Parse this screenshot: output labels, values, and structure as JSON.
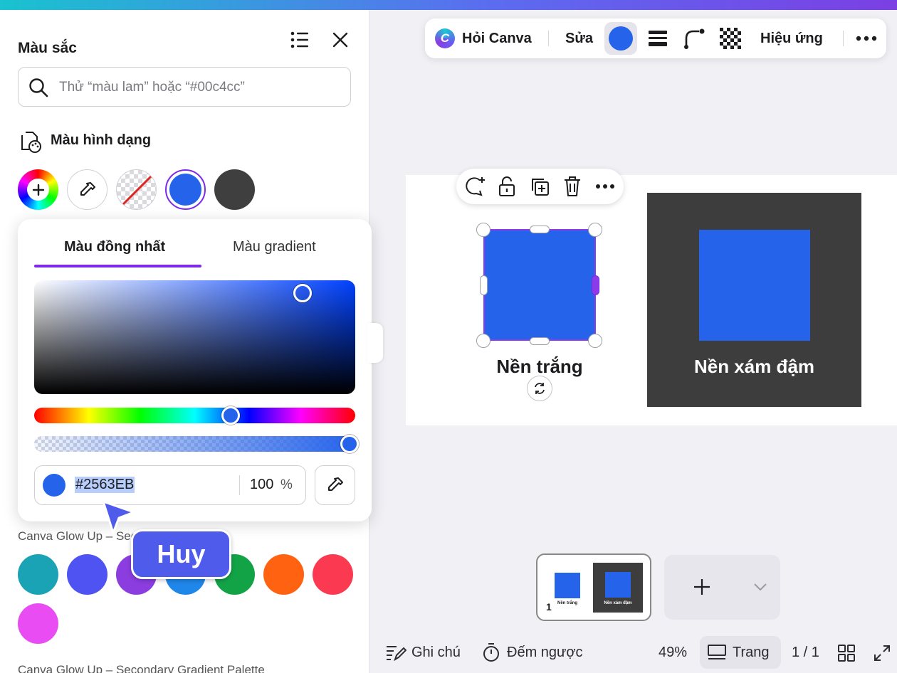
{
  "panel": {
    "title": "Màu sắc",
    "search_placeholder": "Thử “màu lam” hoặc “#00c4cc”",
    "section_label": "Màu hình dạng",
    "doc_colors": [
      "#2563EB",
      "#3F3F3F"
    ],
    "picker": {
      "tab_solid": "Màu đồng nhất",
      "tab_gradient": "Màu gradient",
      "hex_value": "#2563EB",
      "opacity": "100",
      "opacity_unit": "%"
    },
    "palette1_label": "Canva Glow Up – Secondary Palette",
    "palette1_colors": [
      "#1aa3b4",
      "#4f53f1",
      "#8b3ddf",
      "#1f86ea",
      "#13a347",
      "#ff6312",
      "#fb3a52",
      "#e84cf2"
    ],
    "palette2_label": "Canva Glow Up – Secondary Gradient Palette"
  },
  "toolbar": {
    "ask_canva": "Hỏi Canva",
    "edit": "Sửa",
    "current_color": "#2563EB",
    "effects": "Hiệu ứng"
  },
  "canvas": {
    "shape_color": "#2563EB",
    "dark_bg_color": "#3D3D3D",
    "label_white": "Nền trắng",
    "label_dark": "Nền xám đậm"
  },
  "thumbnail": {
    "page_number": "1",
    "label_white": "Nền trắng",
    "label_dark": "Nền xám đậm"
  },
  "cursor": {
    "user_name": "Huy"
  },
  "bottom": {
    "notes": "Ghi chú",
    "timer": "Đếm ngược",
    "zoom": "49%",
    "pages_button": "Trang",
    "page_count": "1 / 1"
  }
}
